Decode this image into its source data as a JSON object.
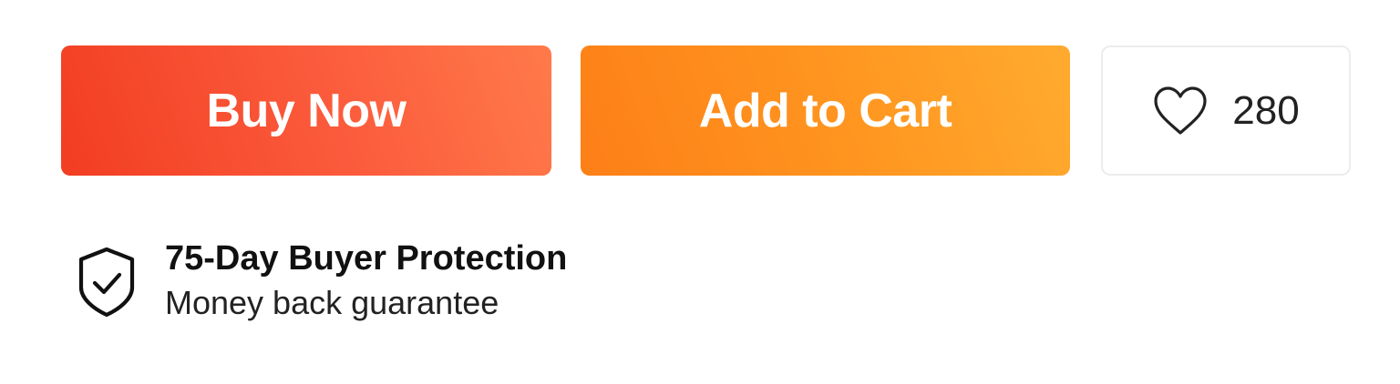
{
  "actions": {
    "buy_now_label": "Buy Now",
    "add_to_cart_label": "Add to Cart",
    "wishlist_icon": "heart-icon",
    "wishlist_count": "280"
  },
  "protection": {
    "icon": "shield-check-icon",
    "title": "75-Day Buyer Protection",
    "subtitle": "Money back guarantee"
  },
  "colors": {
    "buy_now_start": "#f23d22",
    "buy_now_end": "#ff7a4a",
    "add_to_cart_start": "#fd7f17",
    "add_to_cart_end": "#ffab2f"
  }
}
